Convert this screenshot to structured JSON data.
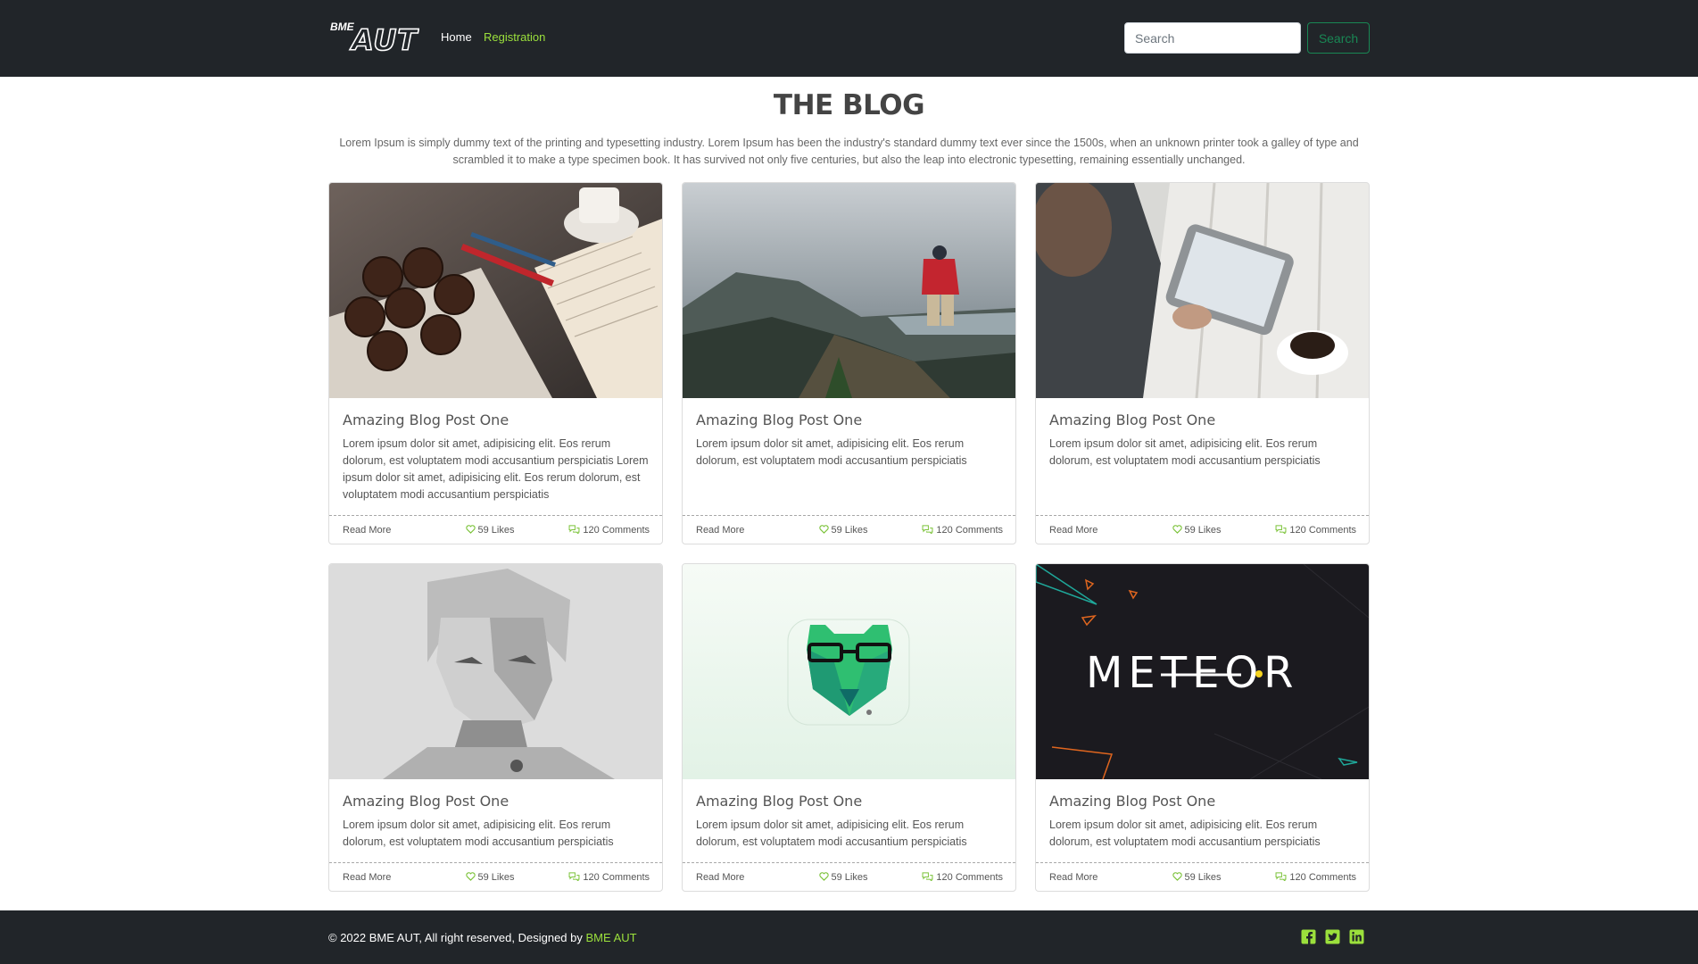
{
  "brand": {
    "logo_small": "BME",
    "logo_large": "AUT",
    "accent_color": "#9be03c"
  },
  "nav": {
    "home": "Home",
    "registration": "Registration"
  },
  "search": {
    "placeholder": "Search",
    "button": "Search"
  },
  "page": {
    "title": "THE BLOG",
    "intro": "Lorem Ipsum is simply dummy text of the printing and typesetting industry. Lorem Ipsum has been the industry's standard dummy text ever since the 1500s, when an unknown printer took a galley of type and scrambled it to make a type specimen book. It has survived not only five centuries, but also the leap into electronic typesetting, remaining essentially unchanged."
  },
  "posts": [
    {
      "image": "muffins-and-book",
      "title": "Amazing Blog Post One",
      "text": "Lorem ipsum dolor sit amet, adipisicing elit. Eos rerum dolorum, est voluptatem modi accusantium perspiciatis Lorem ipsum dolor sit amet, adipisicing elit. Eos rerum dolorum, est voluptatem modi accusantium perspiciatis",
      "read_more": "Read More",
      "likes": "59 Likes",
      "comments": "120 Comments"
    },
    {
      "image": "hiker-on-mountain",
      "title": "Amazing Blog Post One",
      "text": "Lorem ipsum dolor sit amet, adipisicing elit. Eos rerum dolorum, est voluptatem modi accusantium perspiciatis",
      "read_more": "Read More",
      "likes": "59 Likes",
      "comments": "120 Comments"
    },
    {
      "image": "man-with-tablet",
      "title": "Amazing Blog Post One",
      "text": "Lorem ipsum dolor sit amet, adipisicing elit. Eos rerum dolorum, est voluptatem modi accusantium perspiciatis",
      "read_more": "Read More",
      "likes": "59 Likes",
      "comments": "120 Comments"
    },
    {
      "image": "low-poly-portrait",
      "title": "Amazing Blog Post One",
      "text": "Lorem ipsum dolor sit amet, adipisicing elit. Eos rerum dolorum, est voluptatem modi accusantium perspiciatis",
      "read_more": "Read More",
      "likes": "59 Likes",
      "comments": "120 Comments"
    },
    {
      "image": "green-bear-icon",
      "title": "Amazing Blog Post One",
      "text": "Lorem ipsum dolor sit amet, adipisicing elit. Eos rerum dolorum, est voluptatem modi accusantium perspiciatis",
      "read_more": "Read More",
      "likes": "59 Likes",
      "comments": "120 Comments"
    },
    {
      "image": "meteor-logo",
      "image_text": "METEOR",
      "title": "Amazing Blog Post One",
      "text": "Lorem ipsum dolor sit amet, adipisicing elit. Eos rerum dolorum, est voluptatem modi accusantium perspiciatis",
      "read_more": "Read More",
      "likes": "59 Likes",
      "comments": "120 Comments"
    }
  ],
  "footer": {
    "copyright": "© 2022 BME AUT, All right reserved, Designed by",
    "designer": "BME AUT",
    "social": [
      "facebook-icon",
      "twitter-icon",
      "linkedin-icon"
    ]
  }
}
